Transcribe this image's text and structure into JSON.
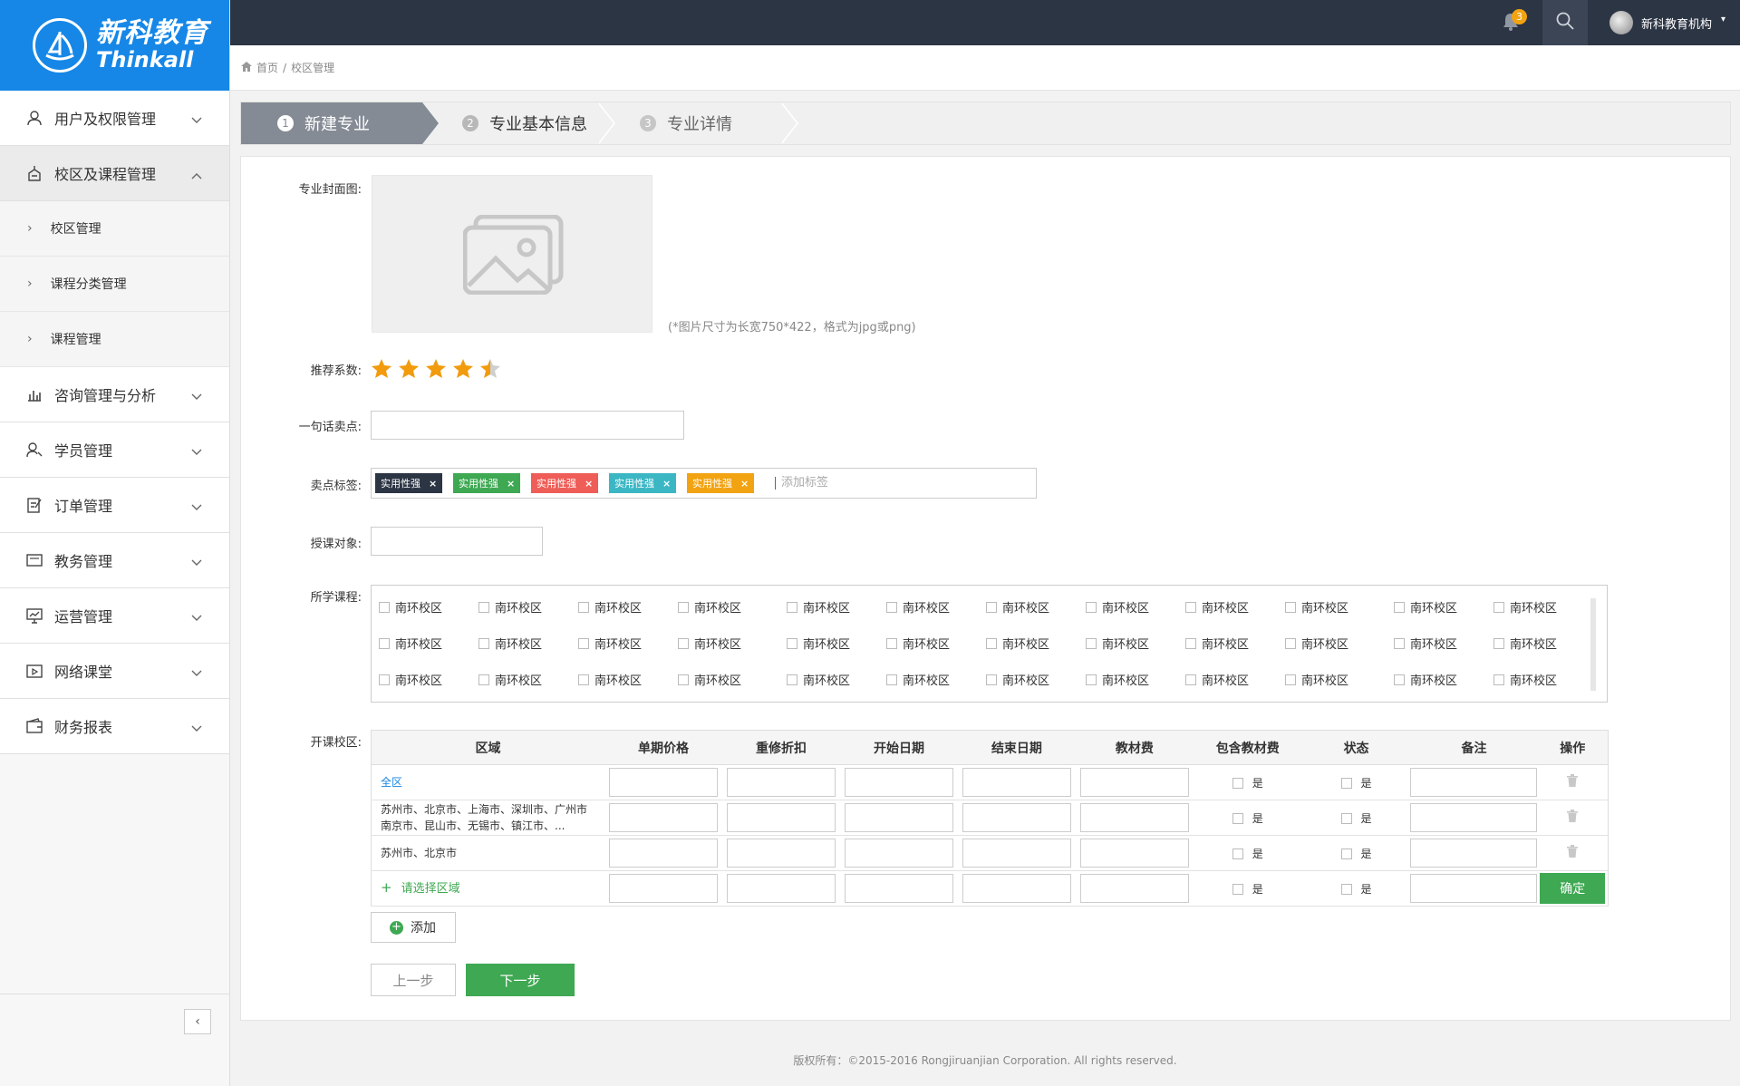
{
  "brand": {
    "name_cn": "新科教育",
    "name_en": "Thinkall"
  },
  "sidebar": {
    "items": [
      {
        "label": "用户及权限管理",
        "icon": "user-icon"
      },
      {
        "label": "校区及课程管理",
        "icon": "campus-icon",
        "expanded": true
      },
      {
        "label": "咨询管理与分析",
        "icon": "chart-icon"
      },
      {
        "label": "学员管理",
        "icon": "students-icon"
      },
      {
        "label": "订单管理",
        "icon": "order-icon"
      },
      {
        "label": "教务管理",
        "icon": "erp-icon"
      },
      {
        "label": "运营管理",
        "icon": "monitor-icon"
      },
      {
        "label": "网络课堂",
        "icon": "video-icon"
      },
      {
        "label": "财务报表",
        "icon": "wallet-icon"
      }
    ],
    "subitems": [
      "校区管理",
      "课程分类管理",
      "课程管理"
    ]
  },
  "header": {
    "notification_count": "3",
    "org_name": "新科教育机构"
  },
  "breadcrumb": {
    "home": "首页",
    "sep": "/",
    "current": "校区管理"
  },
  "steps": [
    {
      "num": "1",
      "label": "新建专业"
    },
    {
      "num": "2",
      "label": "专业基本信息"
    },
    {
      "num": "3",
      "label": "专业详情"
    }
  ],
  "form": {
    "cover_label": "专业封面图:",
    "cover_hint": "(*图片尺寸为长宽750*422，格式为jpg或png)",
    "rating_label": "推荐系数:",
    "rating_value": 4.5,
    "slogan_label": "一句话卖点:",
    "slogan_value": "",
    "tags_label": "卖点标签:",
    "tags": [
      {
        "text": "实用性强",
        "color": "#2c3544"
      },
      {
        "text": "实用性强",
        "color": "#3ea852"
      },
      {
        "text": "实用性强",
        "color": "#ee5d57"
      },
      {
        "text": "实用性强",
        "color": "#3bb7c4"
      },
      {
        "text": "实用性强",
        "color": "#f2a312"
      }
    ],
    "tag_placeholder": "添加标签",
    "audience_label": "授课对象:",
    "courses_label": "所学课程:",
    "course_option": "南环校区",
    "campus_label": "开课校区:"
  },
  "table": {
    "headers": [
      "区域",
      "单期价格",
      "重修折扣",
      "开始日期",
      "结束日期",
      "教材费",
      "包含教材费",
      "状态",
      "备注",
      "操作"
    ],
    "rows": [
      {
        "region": "全区",
        "region_link": true
      },
      {
        "region": "苏州市、北京市、上海市、深圳市、广州市南京市、昆山市、无锡市、镇江市、..."
      },
      {
        "region": "苏州市、北京市"
      }
    ],
    "new_row_label": "请选择区域",
    "checkbox_label": "是",
    "confirm": "确定"
  },
  "buttons": {
    "add": "添加",
    "prev": "上一步",
    "next": "下一步"
  },
  "footer": "版权所有：©2015-2016 Rongjiruanjian Corporation. All rights reserved."
}
